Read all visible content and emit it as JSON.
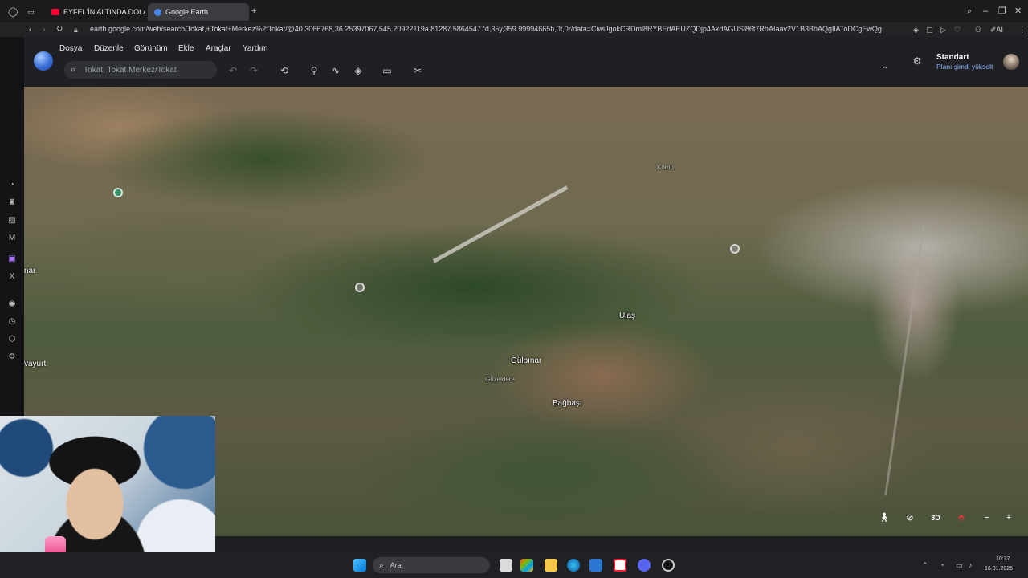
{
  "browser": {
    "tabs": [
      {
        "title": "EYFEL'İN ALTINDA DOLAN",
        "favicon": "youtube-icon",
        "active": false
      },
      {
        "title": "Google Earth",
        "favicon": "google-earth-icon",
        "active": true
      }
    ],
    "url": "earth.google.com/web/search/Tokat,+Tokat+Merkez%2fTokat/@40.3066768,36.25397067,545.20922119a,81287.58645477d,35y,359.99994665h,0t,0r/data=CiwiJgokCRDml8RYBEdAEUZQDjp4AkdAGUSl86t7RhAIaav2V1B3BhAQgIlAToDCgEwQg",
    "addressbar_right_label": "AI"
  },
  "app": {
    "menus": [
      "Dosya",
      "Düzenle",
      "Görünüm",
      "Ekle",
      "Araçlar",
      "Yardım"
    ],
    "search": {
      "value": "",
      "placeholder": "Tokat, Tokat Merkez/Tokat"
    },
    "toolbar_icons": [
      "undo-icon",
      "redo-icon",
      "voyager-history-icon",
      "add-placemark-icon",
      "add-path-icon",
      "layers-icon",
      "measure-icon",
      "capture-icon"
    ],
    "account": {
      "plan": "Standart",
      "upgrade": "Planı şimdi yükselt"
    }
  },
  "map": {
    "labels": {
      "ulas": "Ulaş",
      "gulpinar": "Gülpınar",
      "bagbasi": "Bağbaşı",
      "guzeldere": "Güzeldere",
      "left_edge": "nar",
      "left_edge_2": "vayurt",
      "komu": "Kömü"
    },
    "controls": {
      "view_3d": "3D"
    }
  },
  "taskbar": {
    "search_placeholder": "Ara",
    "time": "10:37",
    "date": "16.01.2025"
  }
}
